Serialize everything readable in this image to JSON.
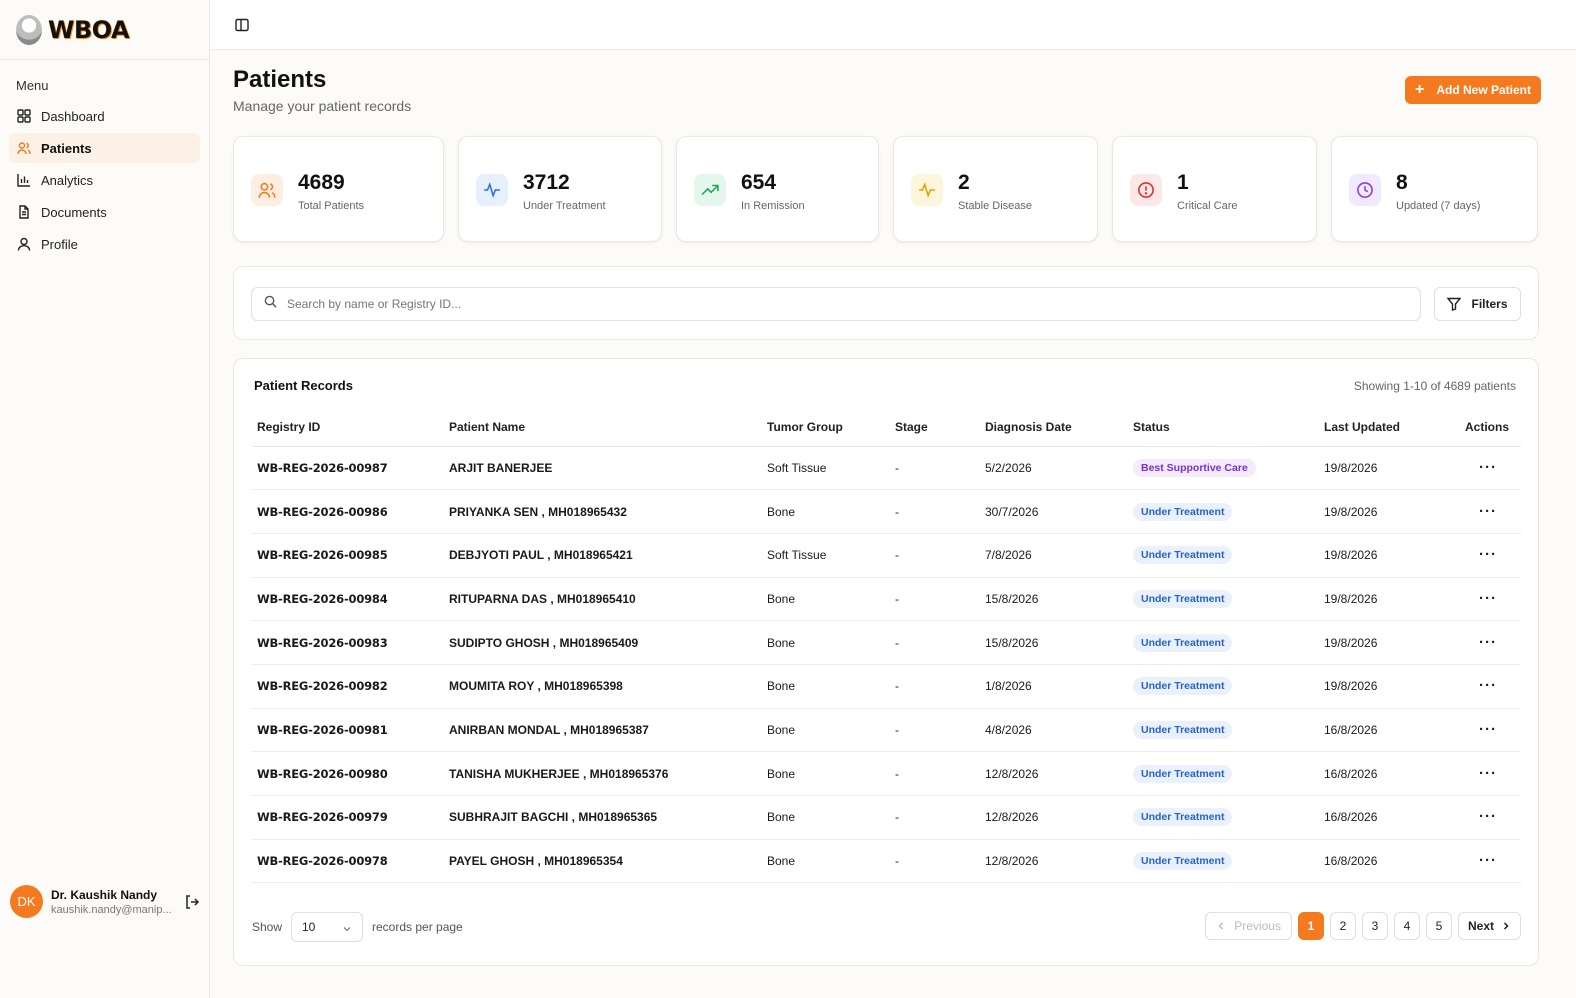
{
  "brand": {
    "name": "WBOA"
  },
  "sidebar": {
    "menu_title": "Menu",
    "items": [
      {
        "label": "Dashboard",
        "icon": "grid-icon",
        "active": false
      },
      {
        "label": "Patients",
        "icon": "users-icon",
        "active": true
      },
      {
        "label": "Analytics",
        "icon": "bar-chart-icon",
        "active": false
      },
      {
        "label": "Documents",
        "icon": "document-icon",
        "active": false
      },
      {
        "label": "Profile",
        "icon": "user-icon",
        "active": false
      }
    ],
    "user": {
      "initials": "DK",
      "name": "Dr. Kaushik Nandy",
      "email": "kaushik.nandy@manip..."
    }
  },
  "header": {
    "title": "Patients",
    "subtitle": "Manage your patient records",
    "add_button_label": "Add New Patient"
  },
  "stats": [
    {
      "value": "4689",
      "label": "Total Patients",
      "icon": "users-icon",
      "color": "#f47a1f",
      "bg": "#fdeee2"
    },
    {
      "value": "3712",
      "label": "Under Treatment",
      "icon": "activity-icon",
      "color": "#2f6fdb",
      "bg": "#e6effc"
    },
    {
      "value": "654",
      "label": "In Remission",
      "icon": "trending-up-icon",
      "color": "#1fa355",
      "bg": "#e5f6ec"
    },
    {
      "value": "2",
      "label": "Stable Disease",
      "icon": "activity-icon",
      "color": "#e0a400",
      "bg": "#fdf5dc"
    },
    {
      "value": "1",
      "label": "Critical Care",
      "icon": "alert-circle-icon",
      "color": "#e02d2d",
      "bg": "#fde8e8"
    },
    {
      "value": "8",
      "label": "Updated (7 days)",
      "icon": "clock-icon",
      "color": "#8b3fe0",
      "bg": "#f1e9fd"
    }
  ],
  "search": {
    "placeholder": "Search by name or Registry ID...",
    "filters_label": "Filters"
  },
  "records": {
    "title": "Patient Records",
    "showing": "Showing 1-10 of 4689 patients",
    "columns": [
      "Registry ID",
      "Patient Name",
      "Tumor Group",
      "Stage",
      "Diagnosis Date",
      "Status",
      "Last Updated",
      "Actions"
    ],
    "rows": [
      {
        "id": "WB-REG-2026-00987",
        "name": "ARJIT BANERJEE",
        "group": "Soft Tissue",
        "stage": "-",
        "diagnosis": "5/2/2026",
        "status": "Best Supportive Care",
        "status_type": "supp",
        "updated": "19/8/2026"
      },
      {
        "id": "WB-REG-2026-00986",
        "name": "PRIYANKA SEN , MH018965432",
        "group": "Bone",
        "stage": "-",
        "diagnosis": "30/7/2026",
        "status": "Under Treatment",
        "status_type": "treat",
        "updated": "19/8/2026"
      },
      {
        "id": "WB-REG-2026-00985",
        "name": "DEBJYOTI PAUL , MH018965421",
        "group": "Soft Tissue",
        "stage": "-",
        "diagnosis": "7/8/2026",
        "status": "Under Treatment",
        "status_type": "treat",
        "updated": "19/8/2026"
      },
      {
        "id": "WB-REG-2026-00984",
        "name": "RITUPARNA DAS , MH018965410",
        "group": "Bone",
        "stage": "-",
        "diagnosis": "15/8/2026",
        "status": "Under Treatment",
        "status_type": "treat",
        "updated": "19/8/2026"
      },
      {
        "id": "WB-REG-2026-00983",
        "name": "SUDIPTO GHOSH , MH018965409",
        "group": "Bone",
        "stage": "-",
        "diagnosis": "15/8/2026",
        "status": "Under Treatment",
        "status_type": "treat",
        "updated": "19/8/2026"
      },
      {
        "id": "WB-REG-2026-00982",
        "name": "MOUMITA ROY , MH018965398",
        "group": "Bone",
        "stage": "-",
        "diagnosis": "1/8/2026",
        "status": "Under Treatment",
        "status_type": "treat",
        "updated": "19/8/2026"
      },
      {
        "id": "WB-REG-2026-00981",
        "name": "ANIRBAN MONDAL , MH018965387",
        "group": "Bone",
        "stage": "-",
        "diagnosis": "4/8/2026",
        "status": "Under Treatment",
        "status_type": "treat",
        "updated": "16/8/2026"
      },
      {
        "id": "WB-REG-2026-00980",
        "name": "TANISHA MUKHERJEE , MH018965376",
        "group": "Bone",
        "stage": "-",
        "diagnosis": "12/8/2026",
        "status": "Under Treatment",
        "status_type": "treat",
        "updated": "16/8/2026"
      },
      {
        "id": "WB-REG-2026-00979",
        "name": "SUBHRAJIT BAGCHI , MH018965365",
        "group": "Bone",
        "stage": "-",
        "diagnosis": "12/8/2026",
        "status": "Under Treatment",
        "status_type": "treat",
        "updated": "16/8/2026"
      },
      {
        "id": "WB-REG-2026-00978",
        "name": "PAYEL GHOSH , MH018965354",
        "group": "Bone",
        "stage": "-",
        "diagnosis": "12/8/2026",
        "status": "Under Treatment",
        "status_type": "treat",
        "updated": "16/8/2026"
      }
    ]
  },
  "pagination": {
    "show_label": "Show",
    "page_size": "10",
    "per_page_label": "records per page",
    "previous_label": "Previous",
    "next_label": "Next",
    "pages": [
      "1",
      "2",
      "3",
      "4",
      "5"
    ],
    "current": "1"
  },
  "colors": {
    "accent": "#f47a1f"
  }
}
